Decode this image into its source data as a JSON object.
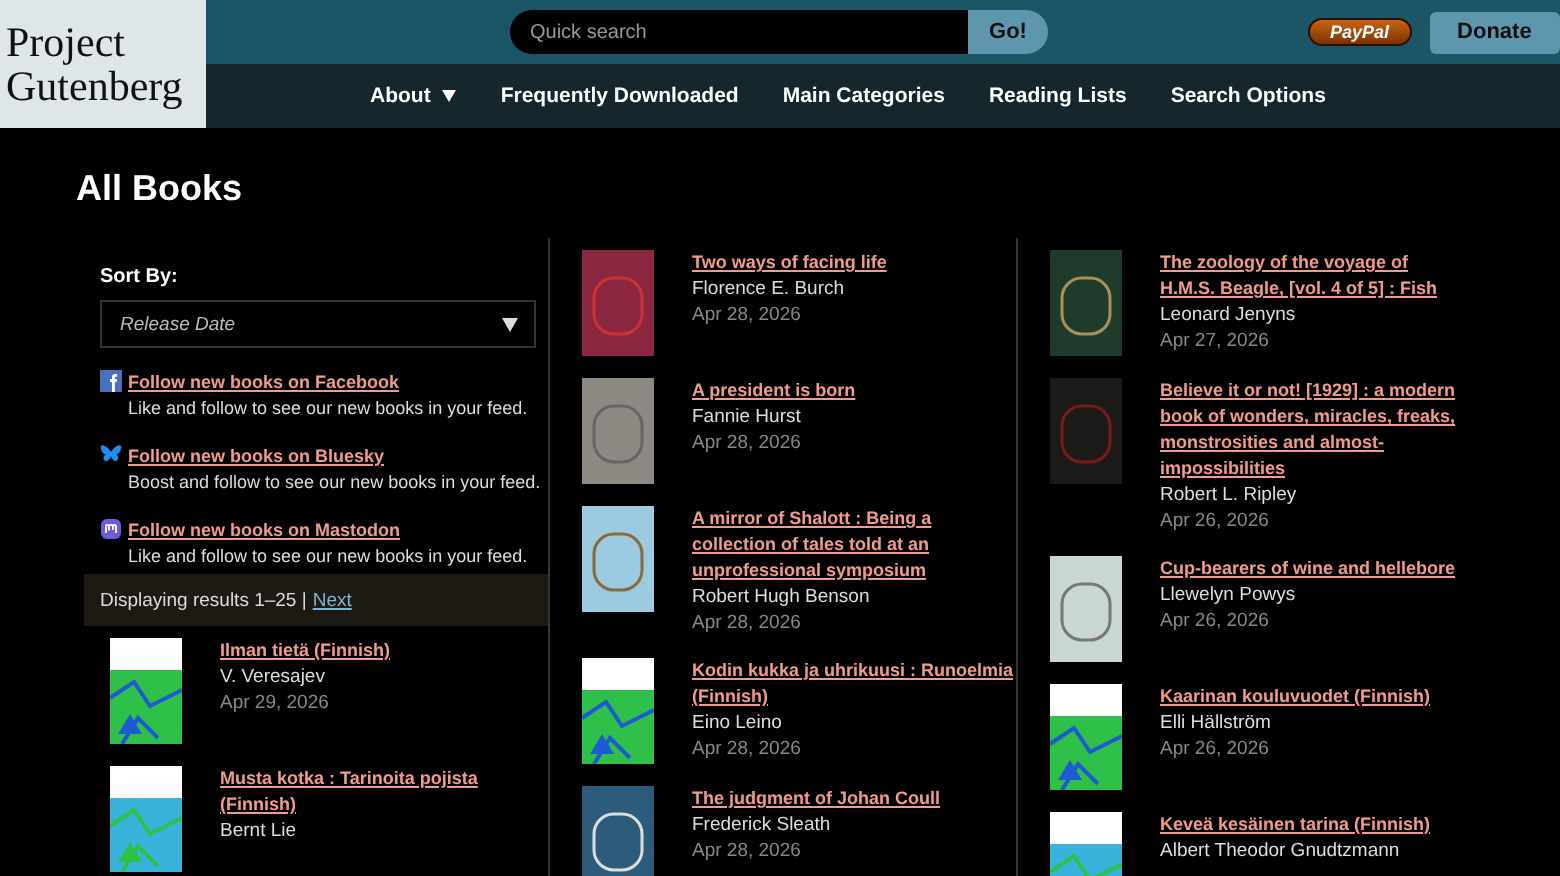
{
  "logo": {
    "line_1": "Project",
    "line_2": "Gutenberg"
  },
  "search": {
    "placeholder": "Quick search",
    "button": "Go!"
  },
  "paypal": "PayPal",
  "donate": "Donate",
  "nav": [
    {
      "label": "About",
      "dropdown": true
    },
    {
      "label": "Frequently Downloaded",
      "dropdown": false
    },
    {
      "label": "Main Categories",
      "dropdown": false
    },
    {
      "label": "Reading Lists",
      "dropdown": false
    },
    {
      "label": "Search Options",
      "dropdown": false
    }
  ],
  "page_title": "All Books",
  "sort": {
    "label": "Sort By:",
    "value": "Release Date"
  },
  "follow": [
    {
      "kind": "facebook",
      "link": "Follow new books on Facebook",
      "text": "Like and follow to see our new books in your feed."
    },
    {
      "kind": "bluesky",
      "link": "Follow new books on Bluesky",
      "text": "Boost and follow to see our new books in your feed."
    },
    {
      "kind": "mastodon",
      "link": "Follow new books on Mastodon",
      "text": "Like and follow to see our new books in your feed."
    }
  ],
  "results": {
    "text": "Displaying results 1–25 |",
    "next": "Next"
  },
  "columns": [
    [
      {
        "kind": "green",
        "title": "Ilman tietä (Finnish)",
        "author": "V. Veresajev",
        "date": "Apr 29, 2026"
      },
      {
        "kind": "blue",
        "title": "Musta kotka : Tarinoita pojista (Finnish)",
        "author": "Bernt Lie"
      }
    ],
    [
      {
        "kind": "red",
        "title": "Two ways of facing life",
        "author": "Florence E. Burch",
        "date": "Apr 28, 2026"
      },
      {
        "kind": "grey",
        "title": "A president is born",
        "author": "Fannie Hurst",
        "date": "Apr 28, 2026"
      },
      {
        "kind": "lightblue",
        "title": "A mirror of Shalott : Being a collection of tales told at an unprofessional symposium",
        "author": "Robert Hugh Benson",
        "date": "Apr 28, 2026"
      },
      {
        "kind": "green",
        "title": "Kodin kukka ja uhrikuusi : Runoelmia (Finnish)",
        "author": "Eino Leino",
        "date": "Apr 28, 2026"
      },
      {
        "kind": "ship",
        "title": "The judgment of Johan Coull",
        "author": "Frederick Sleath",
        "date": "Apr 28, 2026"
      }
    ],
    [
      {
        "kind": "darkgreen",
        "title": "The zoology of the voyage of H.M.S. Beagle, [vol. 4 of 5] : Fish",
        "author": "Leonard Jenyns",
        "date": "Apr 27, 2026"
      },
      {
        "kind": "dark",
        "title": "Believe it or not! [1929] : a modern book of wonders, miracles, freaks, monstrosities and almost-impossibilities",
        "author": "Robert L. Ripley",
        "date": "Apr 26, 2026"
      },
      {
        "kind": "pale",
        "title": "Cup-bearers of wine and hellebore",
        "author": "Llewelyn Powys",
        "date": "Apr 26, 2026"
      },
      {
        "kind": "green",
        "title": "Kaarinan kouluvuodet (Finnish)",
        "author": "Elli Hällström",
        "date": "Apr 26, 2026"
      },
      {
        "kind": "blue",
        "title": "Keveä kesäinen tarina (Finnish)",
        "author": "Albert Theodor Gnudtzmann"
      }
    ]
  ]
}
